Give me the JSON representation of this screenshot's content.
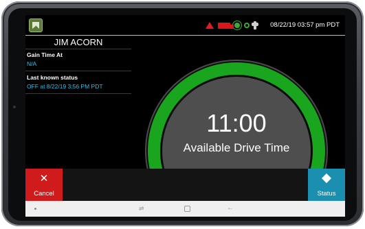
{
  "status_bar": {
    "datetime": "08/22/19 03:57 pm PDT",
    "icons": [
      "app-icon",
      "warning-icon",
      "truck-icon",
      "gps-icon",
      "sync-icon",
      "plug-icon"
    ],
    "warning_color": "#e01b24",
    "accent_color": "#3ca93a"
  },
  "driver": {
    "name": "JIM ACORN"
  },
  "info": {
    "gain_time_label": "Gain Time At",
    "gain_time_value": "N/A",
    "last_status_label": "Last known status",
    "last_status_value": "OFF at 8/22/19 3:56 PM PDT"
  },
  "gauge": {
    "time": "11:00",
    "label": "Available Drive Time",
    "ring_color": "#1aa51e"
  },
  "actions": {
    "cancel_icon": "✕",
    "cancel_label": "Cancel",
    "cancel_color": "#cf1b1b",
    "status_label": "Status",
    "status_color": "#1a8fb0"
  },
  "nav": {
    "recent_glyph": "⇌",
    "back_glyph": "←"
  }
}
